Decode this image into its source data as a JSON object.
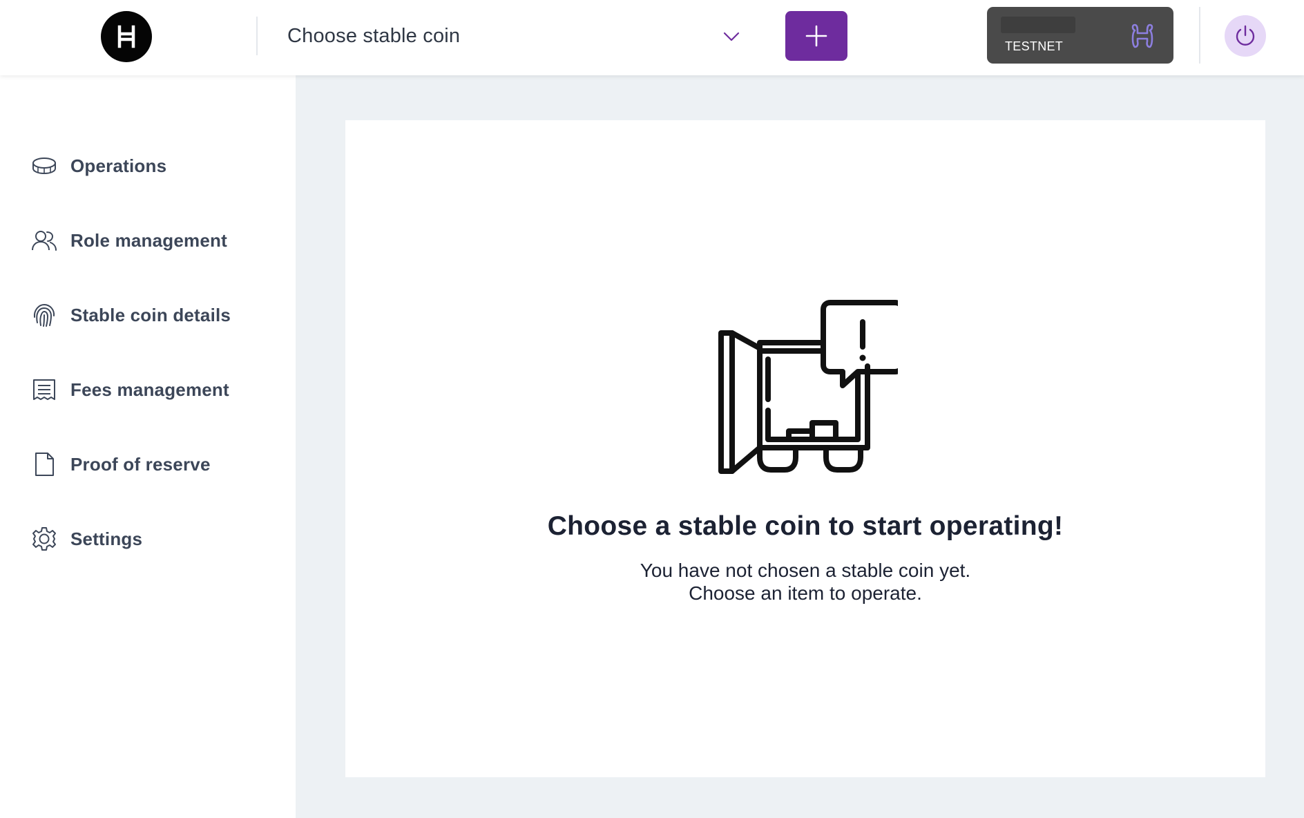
{
  "header": {
    "logo_letter": "H",
    "coin_select_label": "Choose stable coin",
    "add_button_label": "+",
    "network_label": "TESTNET",
    "accent_color": "#6e2c9e"
  },
  "sidebar": {
    "items": [
      {
        "label": "Operations",
        "icon": "coin-icon"
      },
      {
        "label": "Role management",
        "icon": "users-icon"
      },
      {
        "label": "Stable coin details",
        "icon": "fingerprint-icon"
      },
      {
        "label": "Fees management",
        "icon": "receipt-icon"
      },
      {
        "label": "Proof of reserve",
        "icon": "document-icon"
      },
      {
        "label": "Settings",
        "icon": "gear-icon"
      }
    ]
  },
  "main": {
    "empty_state": {
      "title": "Choose a stable coin to start operating!",
      "line1": "You have not chosen a stable coin yet.",
      "line2": "Choose an item to operate."
    }
  }
}
